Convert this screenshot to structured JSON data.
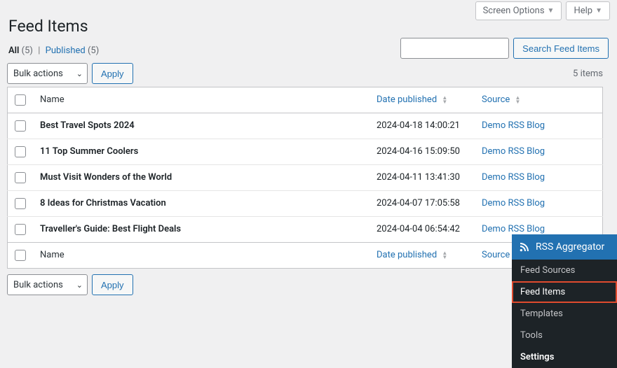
{
  "top_tabs": {
    "screen_options": "Screen Options",
    "help": "Help"
  },
  "page_title": "Feed Items",
  "filters": {
    "all_label": "All",
    "all_count": "(5)",
    "published_label": "Published",
    "published_count": "(5)"
  },
  "search": {
    "button": "Search Feed Items"
  },
  "bulk": {
    "label": "Bulk actions",
    "apply": "Apply"
  },
  "pagination": {
    "count_text": "5 items"
  },
  "columns": {
    "name": "Name",
    "date": "Date published",
    "source": "Source"
  },
  "rows": [
    {
      "name": "Best Travel Spots 2024",
      "date": "2024-04-18 14:00:21",
      "source": "Demo RSS Blog"
    },
    {
      "name": "11 Top Summer Coolers",
      "date": "2024-04-16 15:09:50",
      "source": "Demo RSS Blog"
    },
    {
      "name": "Must Visit Wonders of the World",
      "date": "2024-04-11 13:41:30",
      "source": "Demo RSS Blog"
    },
    {
      "name": "8 Ideas for Christmas Vacation",
      "date": "2024-04-07 17:05:58",
      "source": "Demo RSS Blog"
    },
    {
      "name": "Traveller's Guide: Best Flight Deals",
      "date": "2024-04-04 06:54:42",
      "source": "Demo RSS Blog"
    }
  ],
  "flyout": {
    "title": "RSS Aggregator",
    "items": [
      {
        "label": "Feed Sources",
        "active": false,
        "bold": false
      },
      {
        "label": "Feed Items",
        "active": true,
        "bold": false
      },
      {
        "label": "Templates",
        "active": false,
        "bold": false
      },
      {
        "label": "Tools",
        "active": false,
        "bold": false
      },
      {
        "label": "Settings",
        "active": false,
        "bold": true
      }
    ]
  }
}
